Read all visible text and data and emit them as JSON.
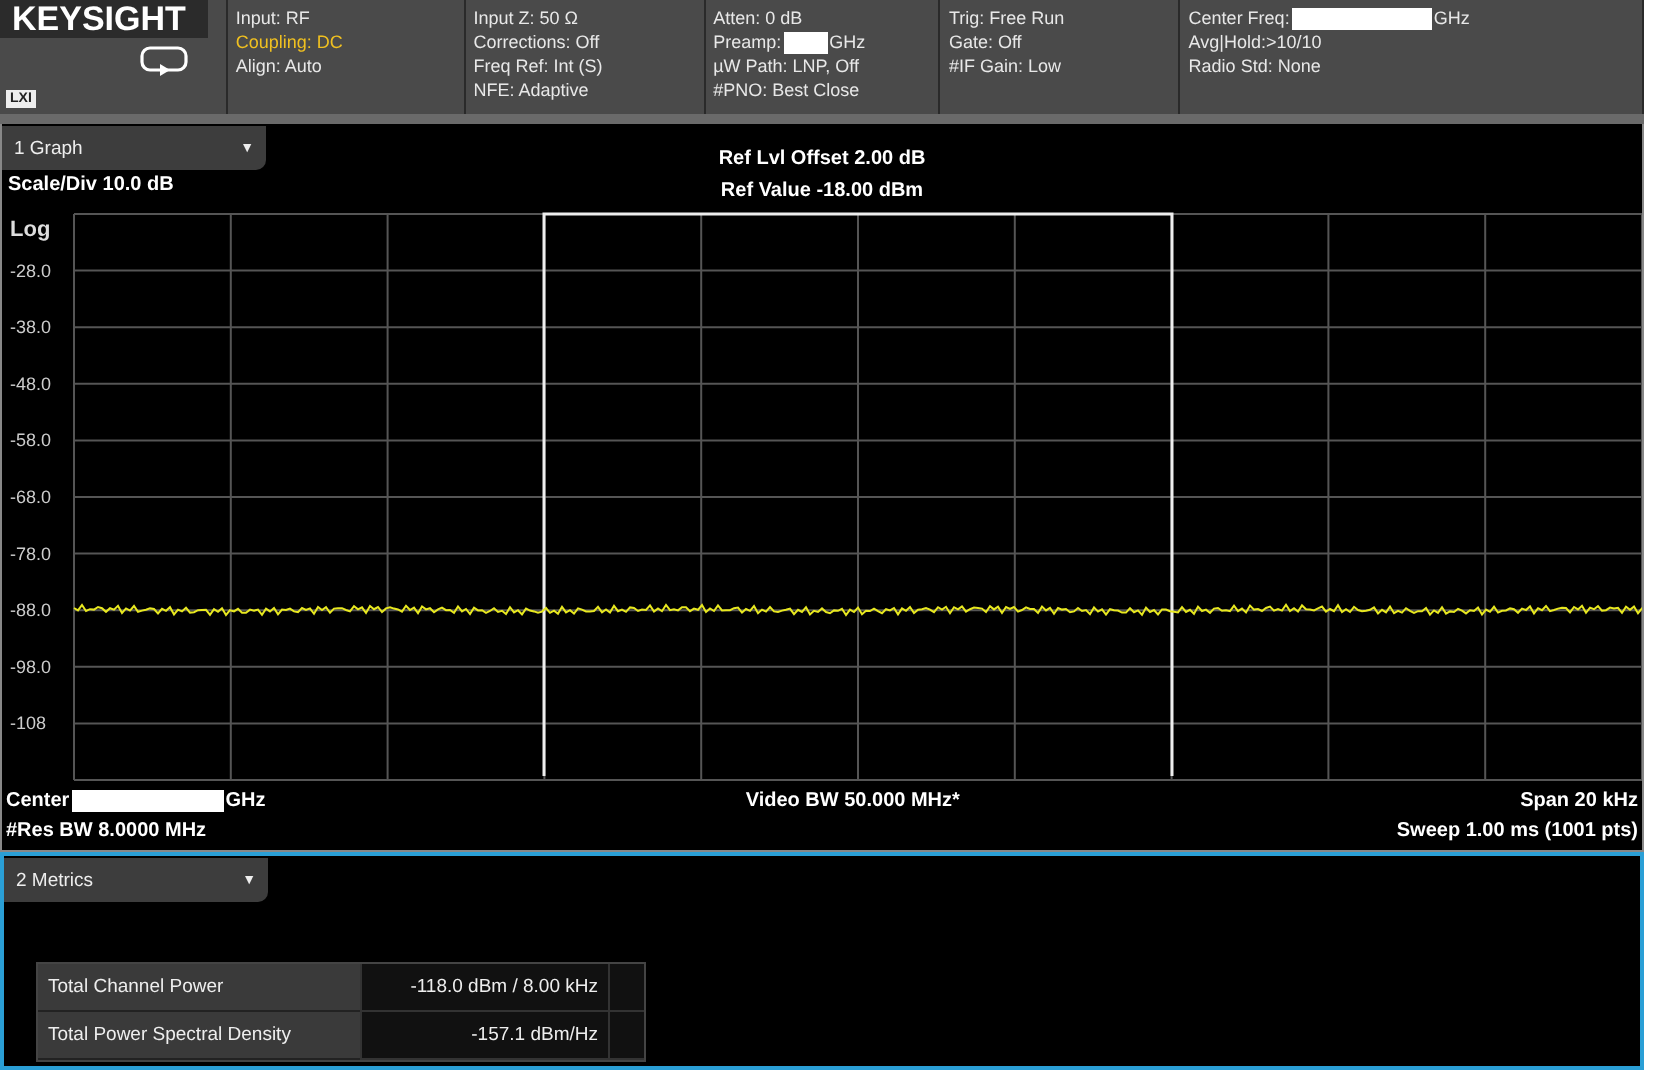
{
  "header": {
    "logo": "KEYSIGHT",
    "badge": "LXI",
    "columns": [
      {
        "lines": [
          {
            "text": "Input: RF",
            "highlight": false
          },
          {
            "text": "Coupling: DC",
            "highlight": true
          },
          {
            "text": "Align: Auto",
            "highlight": false
          }
        ]
      },
      {
        "lines": [
          {
            "text": "Input Z: 50 Ω",
            "highlight": false
          },
          {
            "text": "Corrections: Off",
            "highlight": false
          },
          {
            "text": "Freq Ref: Int (S)",
            "highlight": false
          },
          {
            "text": "NFE: Adaptive",
            "highlight": false
          }
        ]
      },
      {
        "lines": [
          {
            "text": "Atten: 0 dB",
            "highlight": false
          },
          {
            "text": "Preamp:",
            "highlight": false,
            "redacted": true,
            "suffix": "GHz"
          },
          {
            "text": "µW Path: LNP, Off",
            "highlight": false
          },
          {
            "text": "#PNO: Best Close",
            "highlight": false
          }
        ]
      },
      {
        "lines": [
          {
            "text": "Trig: Free Run",
            "highlight": false
          },
          {
            "text": "Gate: Off",
            "highlight": false
          },
          {
            "text": "#IF Gain: Low",
            "highlight": false
          }
        ]
      },
      {
        "lines": [
          {
            "text": "Center Freq:",
            "highlight": false,
            "redacted": true,
            "suffix": "GHz"
          },
          {
            "text": "Avg|Hold:>10/10",
            "highlight": false
          },
          {
            "text": "Radio Std: None",
            "highlight": false
          }
        ]
      }
    ]
  },
  "graph": {
    "tab": "1 Graph",
    "tab_caret": "▼",
    "scale": "Scale/Div 10.0 dB",
    "ref_offset": "Ref Lvl Offset 2.00 dB",
    "ref_value": "Ref Value -18.00 dBm",
    "scale_type": "Log",
    "y_labels": [
      "-28.0",
      "-38.0",
      "-48.0",
      "-58.0",
      "-68.0",
      "-78.0",
      "-88.0",
      "-98.0",
      "-108"
    ],
    "center": {
      "text": "Center",
      "redacted": true,
      "suffix": "GHz"
    },
    "res_bw": "#Res BW 8.0000 MHz",
    "video_bw": "Video BW 50.000 MHz*",
    "span": "Span 20 kHz",
    "sweep": "Sweep 1.00 ms  (1001 pts)"
  },
  "metrics": {
    "tab": "2 Metrics",
    "tab_caret": "▼",
    "rows": [
      {
        "label": "Total Channel Power",
        "value": "-118.0 dBm / 8.00 kHz"
      },
      {
        "label": "Total Power Spectral Density",
        "value": "-157.1 dBm/Hz"
      }
    ]
  }
}
